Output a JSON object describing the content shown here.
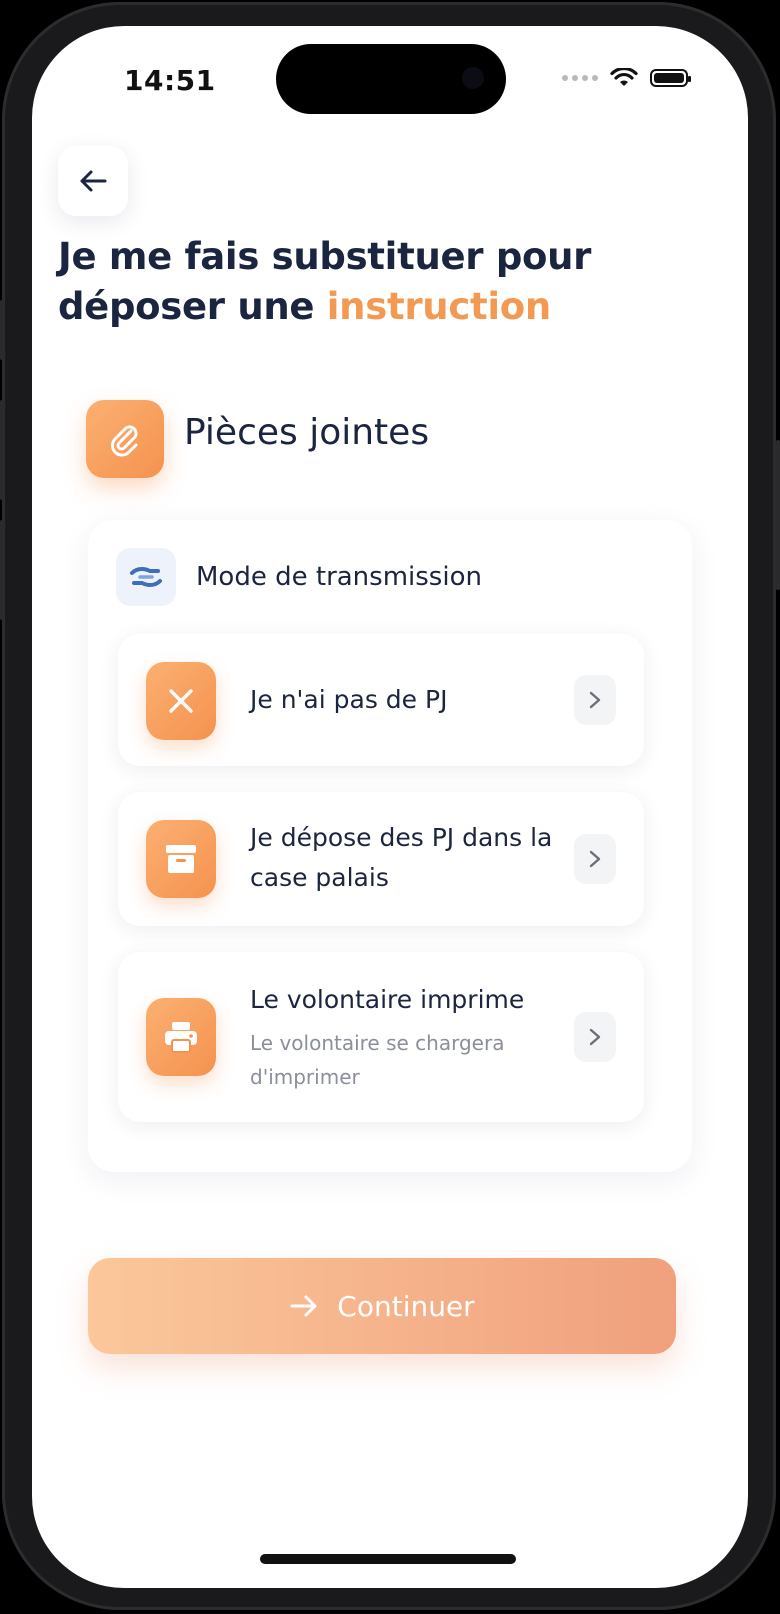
{
  "status_bar": {
    "time": "14:51",
    "wifi_icon": "wifi-icon",
    "battery_icon": "battery-icon"
  },
  "header": {
    "back_icon": "arrow-left-icon",
    "title_part1": "Je me fais substituer pour déposer une ",
    "title_accent": "instruction"
  },
  "section": {
    "icon": "paperclip-icon",
    "title": "Pièces jointes"
  },
  "card": {
    "head_icon": "handshake-icon",
    "head_label": "Mode de transmission",
    "options": [
      {
        "icon": "close-icon",
        "label": "Je n'ai pas de PJ",
        "sublabel": ""
      },
      {
        "icon": "archive-box-icon",
        "label": "Je dépose des PJ dans la case palais",
        "sublabel": ""
      },
      {
        "icon": "printer-icon",
        "label": "Le volontaire imprime",
        "sublabel": "Le volontaire se chargera d'imprimer"
      }
    ]
  },
  "cta": {
    "icon": "arrow-right-icon",
    "label": "Continuer"
  },
  "colors": {
    "accent": "#f39a52",
    "text_dark": "#1c2540",
    "cta_gradient_start": "#fbc79b",
    "cta_gradient_end": "#f0a07d"
  }
}
